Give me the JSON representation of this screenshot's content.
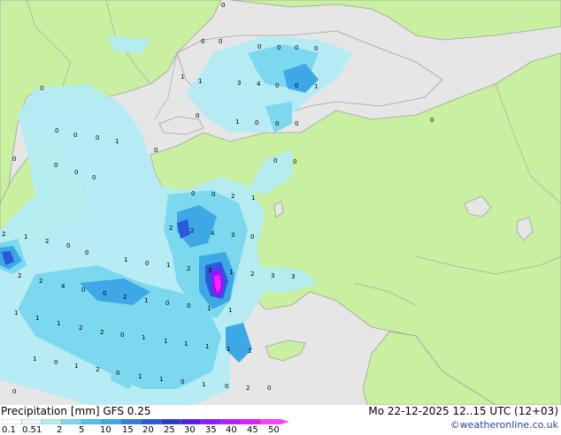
{
  "map": {
    "colors": {
      "land": "#c8f0a0",
      "sea_nodata": "#e6e6e6",
      "coast": "#a0a0a0",
      "precip_light": "#b4ecf4",
      "precip_mid": "#7cd8ee",
      "precip_blue": "#3ea8e6",
      "precip_dark": "#2a5ad6",
      "precip_violet": "#8a1aff",
      "precip_magenta": "#ff20ff"
    },
    "point_labels": [
      "0",
      "0",
      "0",
      "0",
      "0",
      "0",
      "0",
      "1",
      "1",
      "3",
      "4",
      "0",
      "0",
      "1",
      "0",
      "0",
      "1",
      "0",
      "0",
      "0",
      "0",
      "0",
      "0",
      "0",
      "1",
      "0",
      "0",
      "0",
      "0",
      "0",
      "0",
      "0",
      "0",
      "0",
      "2",
      "1",
      "2",
      "2",
      "4",
      "3",
      "0",
      "2",
      "1",
      "2",
      "0",
      "0",
      "1",
      "0",
      "1",
      "2",
      "3",
      "1",
      "2",
      "3",
      "3",
      "2",
      "2",
      "4",
      "0",
      "0",
      "2",
      "1",
      "0",
      "0",
      "1",
      "1",
      "1",
      "1",
      "1",
      "2",
      "2",
      "0",
      "1",
      "1",
      "1",
      "1",
      "1",
      "1",
      "1",
      "0",
      "1",
      "2",
      "0",
      "1",
      "1",
      "0",
      "1",
      "0",
      "2",
      "0",
      "0"
    ]
  },
  "footer": {
    "title_left": "Precipitation [mm]  GFS 0.25",
    "title_right": "Mo 22-12-2025 12..15 UTC (12+03)",
    "credit": "©weatheronline.co.uk",
    "legend_ticks": [
      "0.1",
      "0.5",
      "1",
      "2",
      "5",
      "10",
      "15",
      "20",
      "25",
      "30",
      "35",
      "40",
      "45",
      "50"
    ],
    "legend_colors": [
      "#ffffff",
      "#e6f8fc",
      "#b4ecf4",
      "#7cd8ee",
      "#4cc4ec",
      "#3ea8e6",
      "#3080e0",
      "#2a5ad6",
      "#2a3ac8",
      "#5a1ae6",
      "#8a1aff",
      "#b41aff",
      "#e01aff",
      "#ff40ff"
    ]
  }
}
